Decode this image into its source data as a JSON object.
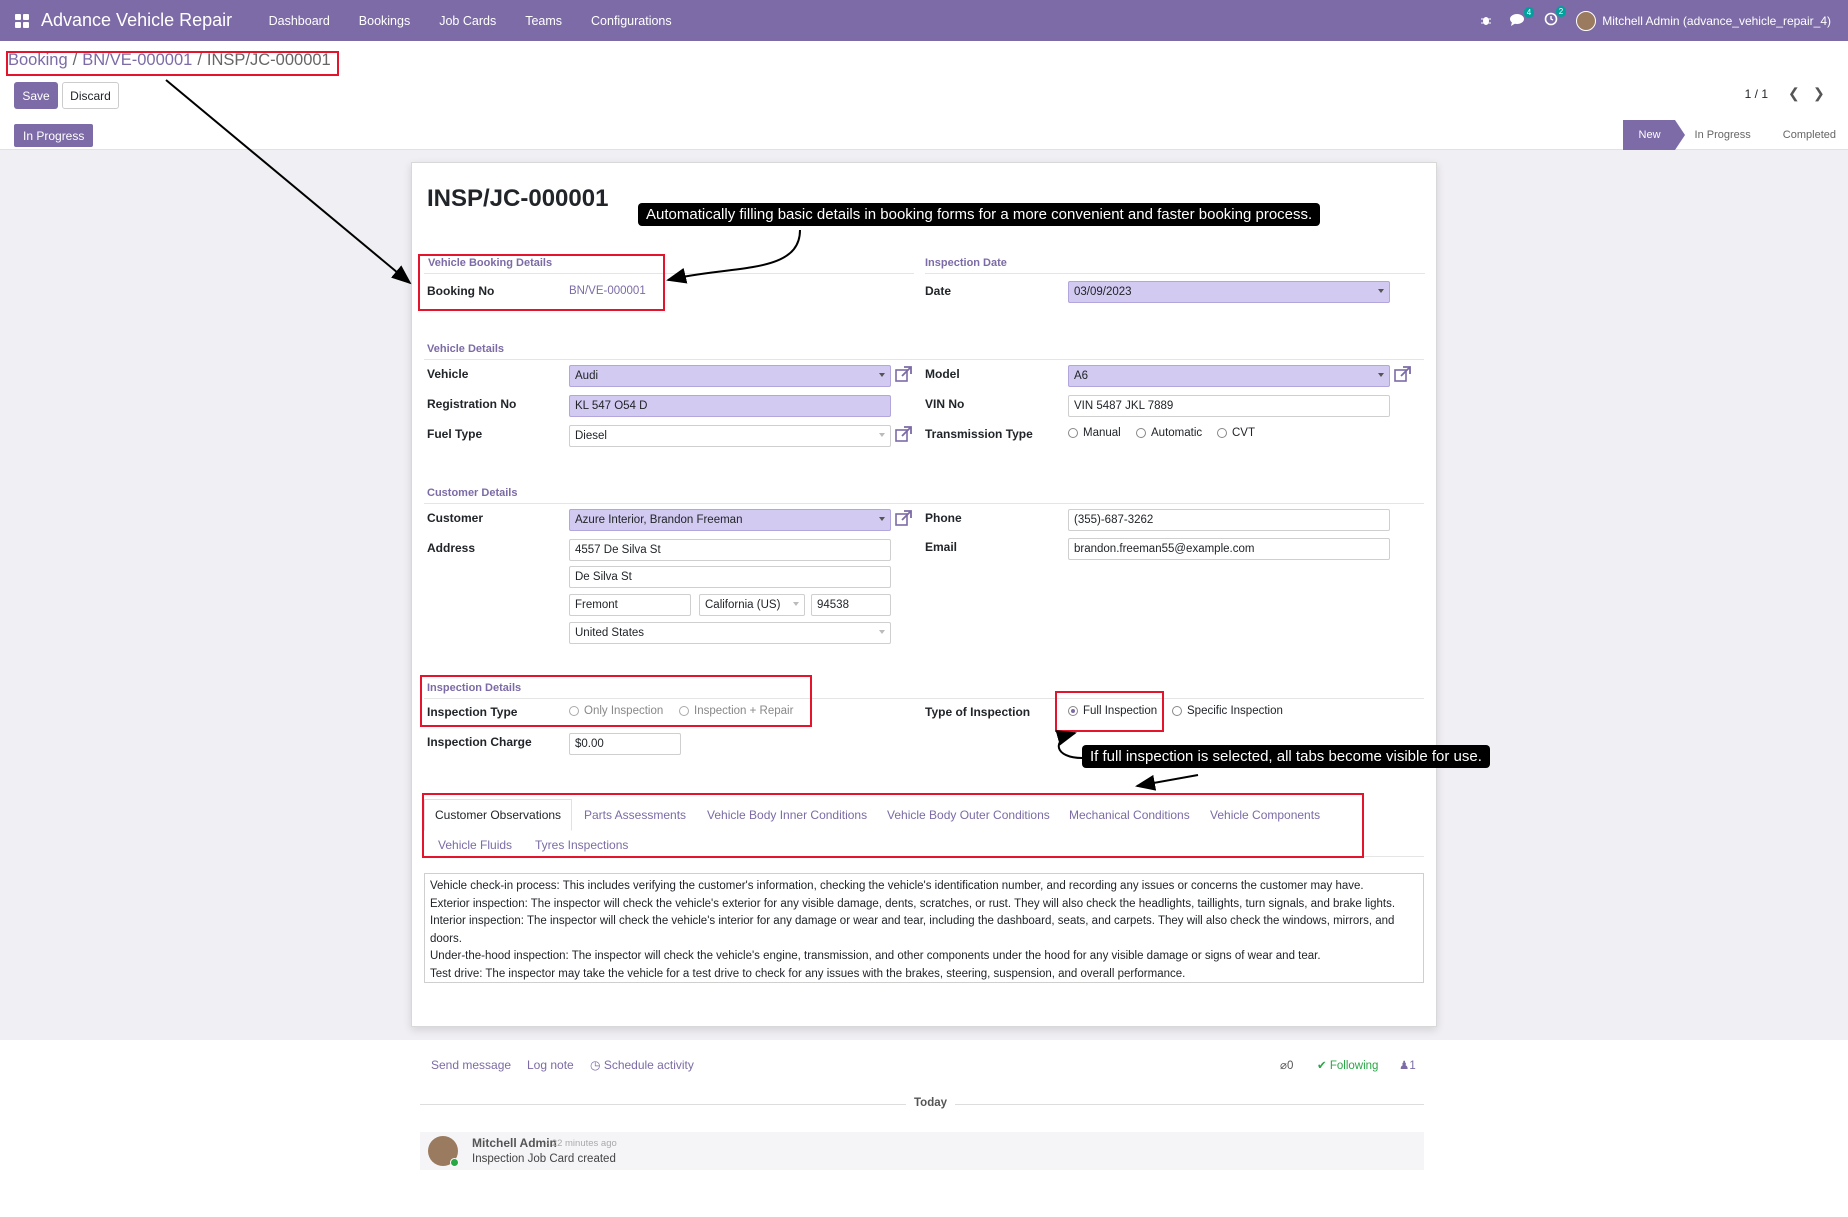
{
  "app": {
    "title": "Advance Vehicle Repair",
    "menu": [
      "Dashboard",
      "Bookings",
      "Job Cards",
      "Teams",
      "Configurations"
    ],
    "messages_badge": "4",
    "activity_badge": "2",
    "user": "Mitchell Admin (advance_vehicle_repair_4)"
  },
  "breadcrumb": {
    "root": "Booking",
    "booking": "BN/VE-000001",
    "current": "INSP/JC-000001"
  },
  "actions": {
    "save": "Save",
    "discard": "Discard"
  },
  "pager": "1 / 1",
  "status_tag": "In Progress",
  "stages": [
    "New",
    "In Progress",
    "Completed"
  ],
  "active_stage": "New",
  "form": {
    "title": "INSP/JC-000001",
    "booking_group": "Vehicle Booking Details",
    "booking_no_label": "Booking No",
    "booking_no": "BN/VE-000001",
    "inspection_date_group": "Inspection Date",
    "date_label": "Date",
    "date": "03/09/2023",
    "vehicle_group": "Vehicle Details",
    "vehicle_label": "Vehicle",
    "vehicle": "Audi",
    "model_label": "Model",
    "model": "A6",
    "reg_label": "Registration No",
    "reg": "KL 547 O54 D",
    "vin_label": "VIN No",
    "vin": "VIN 5487 JKL 7889",
    "fuel_label": "Fuel Type",
    "fuel": "Diesel",
    "transmission_label": "Transmission Type",
    "transmission_options": [
      "Manual",
      "Automatic",
      "CVT"
    ],
    "customer_group": "Customer Details",
    "customer_label": "Customer",
    "customer": "Azure Interior, Brandon Freeman",
    "phone_label": "Phone",
    "phone": "(355)-687-3262",
    "address_label": "Address",
    "street": "4557 De Silva St",
    "street2": "De Silva St",
    "city": "Fremont",
    "state": "California (US)",
    "zip": "94538",
    "country": "United States",
    "email_label": "Email",
    "email": "brandon.freeman55@example.com",
    "inspection_group": "Inspection Details",
    "inspection_type_label": "Inspection Type",
    "inspection_type_options": [
      "Only Inspection",
      "Inspection + Repair"
    ],
    "type_of_inspection_label": "Type of Inspection",
    "type_of_inspection_options": [
      "Full Inspection",
      "Specific Inspection"
    ],
    "charge_label": "Inspection Charge",
    "charge": "$0.00"
  },
  "tabs": [
    "Customer Observations",
    "Parts Assessments",
    "Vehicle Body Inner Conditions",
    "Vehicle Body Outer Conditions",
    "Mechanical Conditions",
    "Vehicle Components",
    "Vehicle Fluids",
    "Tyres Inspections"
  ],
  "notes": [
    "Vehicle check-in process: This includes verifying the customer's information, checking the vehicle's identification number, and recording any issues or concerns the customer may have.",
    "Exterior inspection: The inspector will check the vehicle's exterior for any visible damage, dents, scratches, or rust. They will also check the headlights, taillights, turn signals, and brake lights.",
    "Interior inspection: The inspector will check the vehicle's interior for any damage or wear and tear, including the dashboard, seats, and carpets. They will also check the windows, mirrors, and doors.",
    "Under-the-hood inspection: The inspector will check the vehicle's engine, transmission, and other components under the hood for any visible damage or signs of wear and tear.",
    "Test drive: The inspector may take the vehicle for a test drive to check for any issues with the brakes, steering, suspension, and overall performance."
  ],
  "chatter": {
    "send_message": "Send message",
    "log_note": "Log note",
    "schedule_activity": "Schedule activity",
    "attachments": "0",
    "following": "Following",
    "followers": "1",
    "today": "Today",
    "author": "Mitchell Admin",
    "time": "- 22 minutes ago",
    "body": "Inspection Job Card created"
  },
  "callouts": {
    "booking": "Automatically filling basic details in booking forms for a more convenient and faster booking process.",
    "inspection": "If full inspection is selected, all tabs become visible for use."
  },
  "colors": {
    "brand": "#7c6ba6",
    "highlight": "#e3142c",
    "required": "#d2caf0"
  }
}
